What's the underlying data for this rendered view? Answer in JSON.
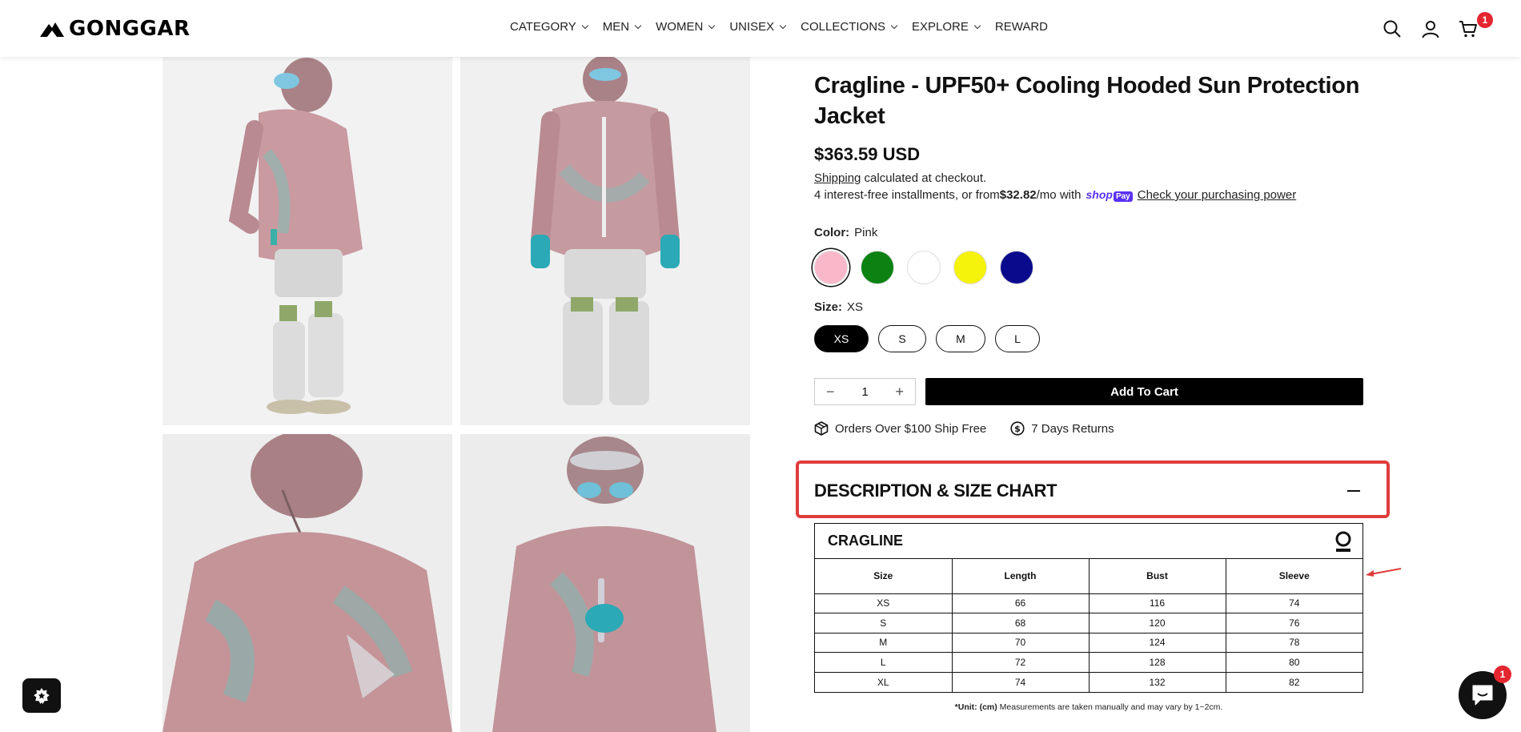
{
  "brand": {
    "name": "GONGGAR"
  },
  "nav": [
    {
      "label": "CATEGORY",
      "has_dropdown": true
    },
    {
      "label": "MEN",
      "has_dropdown": true
    },
    {
      "label": "WOMEN",
      "has_dropdown": true
    },
    {
      "label": "UNISEX",
      "has_dropdown": true
    },
    {
      "label": "COLLECTIONS",
      "has_dropdown": true
    },
    {
      "label": "EXPLORE",
      "has_dropdown": true
    },
    {
      "label": "REWARD",
      "has_dropdown": false
    }
  ],
  "header_icons": {
    "search": "search-icon",
    "account": "user-icon",
    "cart": "cart-icon",
    "cart_count": "1"
  },
  "product": {
    "title": "Cragline - UPF50+ Cooling Hooded Sun Protection Jacket",
    "price": "$363.59 USD",
    "shipping_link": "Shipping",
    "shipping_rest": " calculated at checkout.",
    "installments_prefix": "4 interest-free installments, or from ",
    "installments_amount": "$32.82",
    "installments_suffix": "/mo with",
    "shoppay_label": "shop",
    "shoppay_pay": "Pay",
    "purchasing_power_link": "Check your purchasing power",
    "color_label": "Color:",
    "color_value": "Pink",
    "colors": [
      {
        "name": "pink",
        "hex": "#f9b8c9",
        "selected": true
      },
      {
        "name": "green",
        "hex": "#0b8212",
        "selected": false
      },
      {
        "name": "white",
        "hex": "#ffffff",
        "selected": false
      },
      {
        "name": "yellow",
        "hex": "#f5f20b",
        "selected": false
      },
      {
        "name": "navy",
        "hex": "#0a0a8c",
        "selected": false
      }
    ],
    "size_label": "Size:",
    "size_value": "XS",
    "sizes": [
      {
        "label": "XS",
        "active": true
      },
      {
        "label": "S",
        "active": false
      },
      {
        "label": "M",
        "active": false
      },
      {
        "label": "L",
        "active": false
      }
    ],
    "quantity": "1",
    "qty_minus": "−",
    "qty_plus": "+",
    "add_to_cart": "Add To Cart",
    "perks": [
      {
        "icon": "package-icon",
        "text": "Orders Over $100 Ship Free"
      },
      {
        "icon": "dollar-circle-icon",
        "text": "7 Days Returns"
      }
    ]
  },
  "description": {
    "heading": "DESCRIPTION & SIZE CHART",
    "highlight_color": "#e03c3c"
  },
  "size_chart": {
    "title": "CRAGLINE",
    "columns": [
      "Size",
      "Length",
      "Bust",
      "Sleeve"
    ],
    "rows": [
      [
        "XS",
        "66",
        "116",
        "74"
      ],
      [
        "S",
        "68",
        "120",
        "76"
      ],
      [
        "M",
        "70",
        "124",
        "78"
      ],
      [
        "L",
        "72",
        "128",
        "80"
      ],
      [
        "XL",
        "74",
        "132",
        "82"
      ]
    ],
    "note_bold": "*Unit: (cm)",
    "note_rest": " Measurements are taken manually and may vary by 1~2cm."
  },
  "chat": {
    "badge": "1"
  }
}
